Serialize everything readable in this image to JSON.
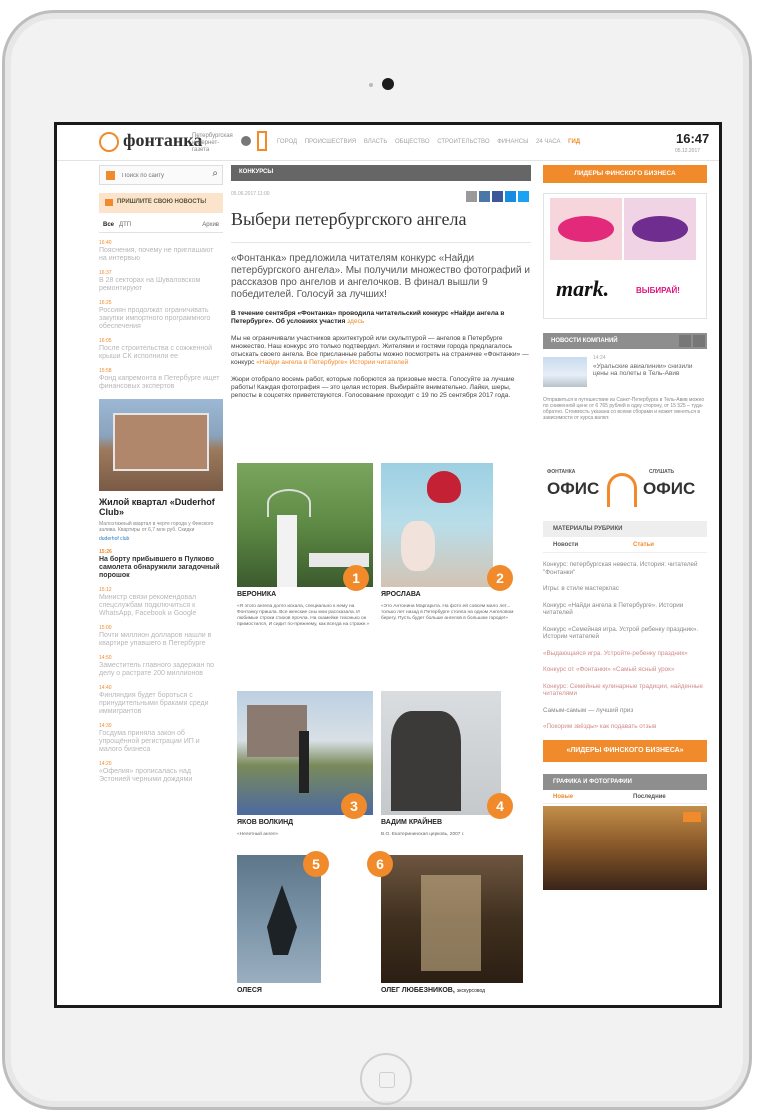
{
  "header": {
    "logo": "фонтанка",
    "tagline": "Петербургская интернет-газета",
    "nav": [
      "ГОРОД",
      "ПРОИСШЕСТВИЯ",
      "ВЛАСТЬ",
      "ОБЩЕСТВО",
      "СТРОИТЕЛЬСТВО",
      "ФИНАНСЫ",
      "24 ЧАСА",
      "ГИД"
    ],
    "time": "16:47",
    "date": "05.12.2017"
  },
  "left": {
    "search_placeholder": "Поиск по сайту",
    "send_news": "ПРИШЛИТЕ СВОЮ НОВОСТЬ!",
    "tab_all": "Все",
    "tab_dtp": "ДТП",
    "tab_archive": "Архив",
    "news": [
      {
        "time": "16:40",
        "text": "Пояснения, почему не приглашают на интервью"
      },
      {
        "time": "16:37",
        "text": "В 28 секторах на Шуваловском ремонтируют"
      },
      {
        "time": "16:25",
        "text": "Россиян продолжат ограничивать закупки импортного программного обеспечения"
      },
      {
        "time": "16:05",
        "text": "После строительства с сожженной крыши СК исполнили ее"
      },
      {
        "time": "15:58",
        "text": "Фонд капремонта в Петербурге ищет финансовых экспертов"
      }
    ],
    "promo": {
      "title": "Жилой квартал «Duderhof Club»",
      "text": "Малоэтажный квартал в черте города у Финского залива. Квартиры от 6,7 млн руб. Скидки",
      "link": "duderhof club"
    },
    "news2": [
      {
        "time": "15:26",
        "text": "На борту прибывшего в Пулково самолета обнаружили загадочный порошок"
      },
      {
        "time": "15:12",
        "text": "Министр связи рекомендовал спецслужбам подключиться к WhatsApp, Facebook и Google"
      },
      {
        "time": "15:00",
        "text": "Почти миллион долларов нашли в квартире упавшего в Петербурге"
      },
      {
        "time": "14:50",
        "text": "Заместитель главного задержан по делу о растрате 200 миллионов"
      },
      {
        "time": "14:40",
        "text": "Финляндия будет бороться с принудительными браками среди иммигрантов"
      },
      {
        "time": "14:30",
        "text": "Госдума приняла закон об упрощённой регистрации ИП и малого бизнеса"
      },
      {
        "time": "14:20",
        "text": "«Офелия» прописалась над Эстонией черными дождями"
      }
    ]
  },
  "article": {
    "section": "КОНКУРСЫ",
    "meta": "05.06.2017 11:00",
    "title": "Выбери петербургского ангела",
    "lead": "«Фонтанка» предложила читателям конкурс «Найди петербургского ангела». Мы получили множество фотографий и рассказов про ангелов и ангелочков. В финал вышли 9 победителей. Голосуй за лучших!",
    "p1_bold": "В течение сентября «Фонтанка» проводила читательский конкурс «Найди ангела в Петербурге». Об условиях участия",
    "p1_link": "здесь",
    "p2": "Мы не ограничивали участников архитектурой или скульптурой — ангелов в Петербурге множество. Наш конкурс это только подтвердил. Жителями и гостями города предлагалось отыскать своего ангела. Все присланные работы можно посмотреть на страничке «Фонтанки» — конкурс",
    "p2_link": "«Найди ангела в Петербурге» Истории читателей",
    "p3": "Жюри отобрало восемь работ, которые поборются за призовые места. Голосуйте за лучшие работы! Каждая фотография — это целая история. Выбирайте внимательно. Лайки, шеры, репосты в соцсетях приветствуются. Голосование проходит с 19 по 25 сентября 2017 года.",
    "photos": [
      {
        "num": "1",
        "name": "ВЕРОНИКА",
        "quote": "«Я этого ангела долго искала, специально к нему на Фонтанку пришла. Все женские сны мои рассказала. И любимые строки стихов прочла. На скамейке тихонько он примостился, И сидит по-прежнему, как всегда на страже.»"
      },
      {
        "num": "2",
        "name": "ЯРОСЛАВА",
        "quote": "«Это Антонина Маргарита. На фото ей совсем мало лет... только лет назад в Петербурге стояла на одном Ангеловом берегу. Пусть будет больше ангелов в большом городе!»"
      },
      {
        "num": "3",
        "name": "ЯКОВ ВОЛКИНД",
        "quote": "«Нелетный ангел»"
      },
      {
        "num": "4",
        "name": "ВАДИМ КРАЙНЕВ",
        "quote": "В.О. Екатерининская церковь, 2007 г."
      },
      {
        "num": "5",
        "name": "ОЛЕСЯ",
        "quote": ""
      },
      {
        "num": "6",
        "name": "ОЛЕГ ЛЮБЕЗНИКОВ,",
        "quote": "экскурсовод"
      }
    ]
  },
  "right": {
    "leaders": "ЛИДЕРЫ ФИНСКОГО БИЗНЕСА",
    "ad_brand": "mark.",
    "ad_cta": "ВЫБИРАЙ!",
    "company_news": "НОВОСТИ КОМПАНИЙ",
    "cnews_time": "14:24",
    "cnews_title": "«Уральские авиалинии» снизили цены на полеты в Тель-Авив",
    "cnews_text": "Отправиться в путешествие из Санкт-Петербурга в Тель-Авив можно по сниженной цене от 6 765 рублей в одну сторону, от 15 525 – туда-обратно. Стоимость указана со всеми сборами и может меняться в зависимости от курса валют.",
    "office_left_top": "ФОНТАНКА",
    "office_left": "ОФИС",
    "office_right_top": "СЛУШАТЬ",
    "office_right": "ОФИС",
    "materials": "МАТЕРИАЛЫ РУБРИКИ",
    "mat_tab1": "Новости",
    "mat_tab2": "Статьи",
    "materials_list": [
      "Конкурс: петербургская невеста. История: читателей \"Фонтанки\"",
      "Игры: в стиле мастерклас",
      "Конкурс «Найди ангела в Петербурге». Истории читателей",
      "Конкурс «Семейная игра. Устрой ребенку праздник». Истории читателей",
      "«Выдающаяся игра. Устройте-ребенку праздник»",
      "Конкурс от «Фонтанки» «Самый ясный урок»",
      "Конкурс: Семейные кулинарные традиции, найденные читателями",
      "Самым-самым — лучший приз",
      "«Покорим звёзды» как подавать отзыв"
    ],
    "leaders_btn": "«ЛИДЕРЫ ФИНСКОГО БИЗНЕСА»",
    "pics": "ГРАФИКА И ФОТОГРАФИИ",
    "pics_tab1": "Новые",
    "pics_tab2": "Последние"
  }
}
